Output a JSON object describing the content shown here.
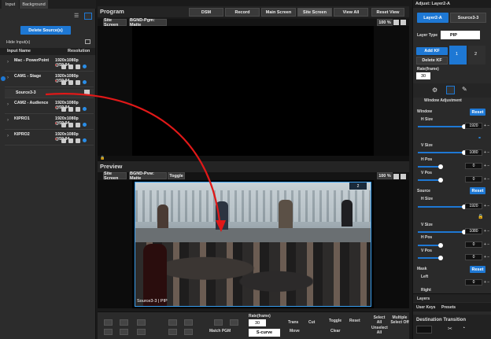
{
  "left": {
    "tabs": [
      "Input",
      "Background"
    ],
    "delete_source_label": "Delete Source(s)",
    "hide_inputs_label": "Hide Input(s)",
    "col_input_name": "Input Name",
    "col_resolution": "Resolution",
    "inputs": [
      {
        "name": "Mac - PowerPoint",
        "resolution": "1920x1080p @59.94"
      },
      {
        "name": "CAM1 - Stage",
        "resolution": "1920x1080p @59.94"
      },
      {
        "name": "Source3-3",
        "resolution": ""
      },
      {
        "name": "CAM2 - Audience",
        "resolution": "1920x1080p @59.94"
      },
      {
        "name": "KIPRO1",
        "resolution": "1920x1080p @59.94"
      },
      {
        "name": "KIPRO2",
        "resolution": "1920x1080p @59.94"
      }
    ]
  },
  "program": {
    "title": "Program",
    "buttons": [
      "DSM",
      "Record",
      "Main Screen",
      "Site Screen",
      "View All",
      "Reset View"
    ],
    "sub_tabs": [
      "Site Screen",
      "BGND-Pgm: Matte"
    ],
    "zoom": "100 %"
  },
  "preview": {
    "title": "Preview",
    "sub_tabs": [
      "Site Screen",
      "BGND-Pvw: Matte",
      "Toggle"
    ],
    "zoom": "100 %",
    "layer_caption": "Source3-3 | PIP",
    "layer_number": "2"
  },
  "right": {
    "header": "Adjust: Layer2-A",
    "layer_tabs": [
      "Layer2-A",
      "Source3-3"
    ],
    "layer_type_label": "Layer Type",
    "layer_type_value": "PIP",
    "add_kf": "Add KF",
    "delete_kf": "Delete KF",
    "rate_label": "Rate(frame)",
    "rate_value": "30",
    "kf_badge_1": "1",
    "kf_badge_2": "2",
    "window_adjustment": "Window Adjustment",
    "window_label": "Window",
    "reset_label": "Reset",
    "h_size_label": "H Size",
    "h_size_value": "1920",
    "v_size_label": "V Size",
    "v_size_value": "1080",
    "h_pos_label": "H Pos",
    "h_pos_value": "0",
    "v_pos_label": "V Pos",
    "v_pos_value": "0",
    "source_label": "Source",
    "src_h_size_value": "1920",
    "src_v_size_value": "1080",
    "src_h_pos_value": "0",
    "src_v_pos_value": "0",
    "mask_label": "Mask",
    "left_label": "Left",
    "left_value": "0",
    "right_label": "Right",
    "layers_tab": "Layers",
    "user_keys_tab": "User Keys",
    "presets_tab": "Presets",
    "dest_transition": "Destination Transition",
    "accent": "#1e78d4"
  },
  "bottom": {
    "match_pgm": "Match PGM",
    "rate_label": "Rate(frame)",
    "rate_value": "30",
    "s_curve": "S-curve",
    "trans": "Trans",
    "cut": "Cut",
    "move": "Move",
    "toggle": "Toggle",
    "reset": "Reset",
    "clear": "Clear",
    "select_all": "Select All",
    "unselect_all": "Unselect All",
    "multiple_select_off": "Multiple Select Off"
  }
}
